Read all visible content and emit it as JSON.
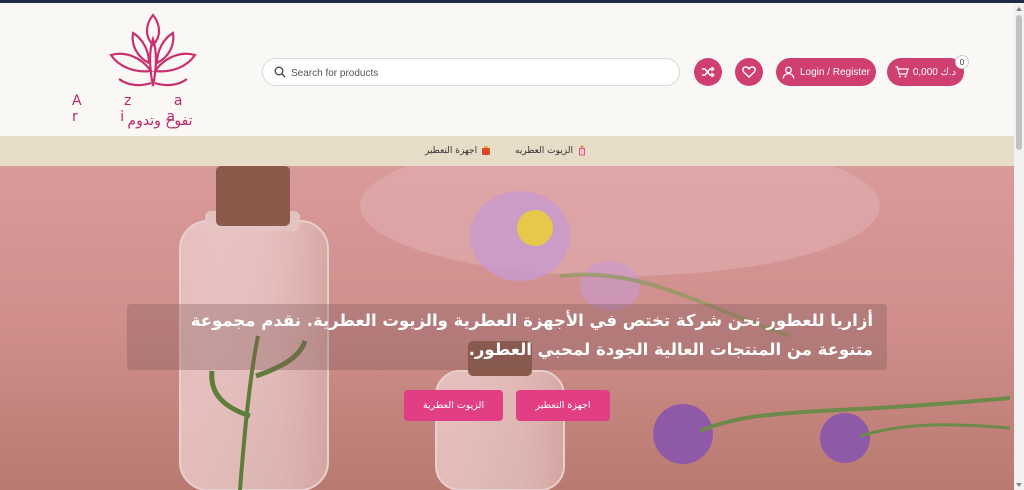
{
  "header": {
    "logo": {
      "brand": "A z a r i a",
      "slogan": "تفوح وتدوم"
    },
    "search": {
      "placeholder": "Search for products"
    },
    "login_label": "Login / Register",
    "cart": {
      "total": "0,000 د.ك",
      "count": "0"
    }
  },
  "nav": {
    "items": [
      {
        "label": "الزيوت العطريه",
        "icon": "oil-bottle-icon"
      },
      {
        "label": "اجهزة التعطير",
        "icon": "diffuser-icon"
      }
    ]
  },
  "hero": {
    "caption": "أزاريا للعطور نحن شركة تختص في الأجهزة العطرية والزيوت العطرية. نقدم مجموعة متنوعة من المنتجات العالية الجودة لمحبي العطور.",
    "buttons": {
      "devices": "اجهزة التعطير",
      "oils": "الزيوت العطرية"
    }
  },
  "colors": {
    "accent": "#cf3f6f",
    "hero_button": "#e13e83",
    "nav_bg": "#e6dcc7",
    "brand": "#b8296a"
  }
}
